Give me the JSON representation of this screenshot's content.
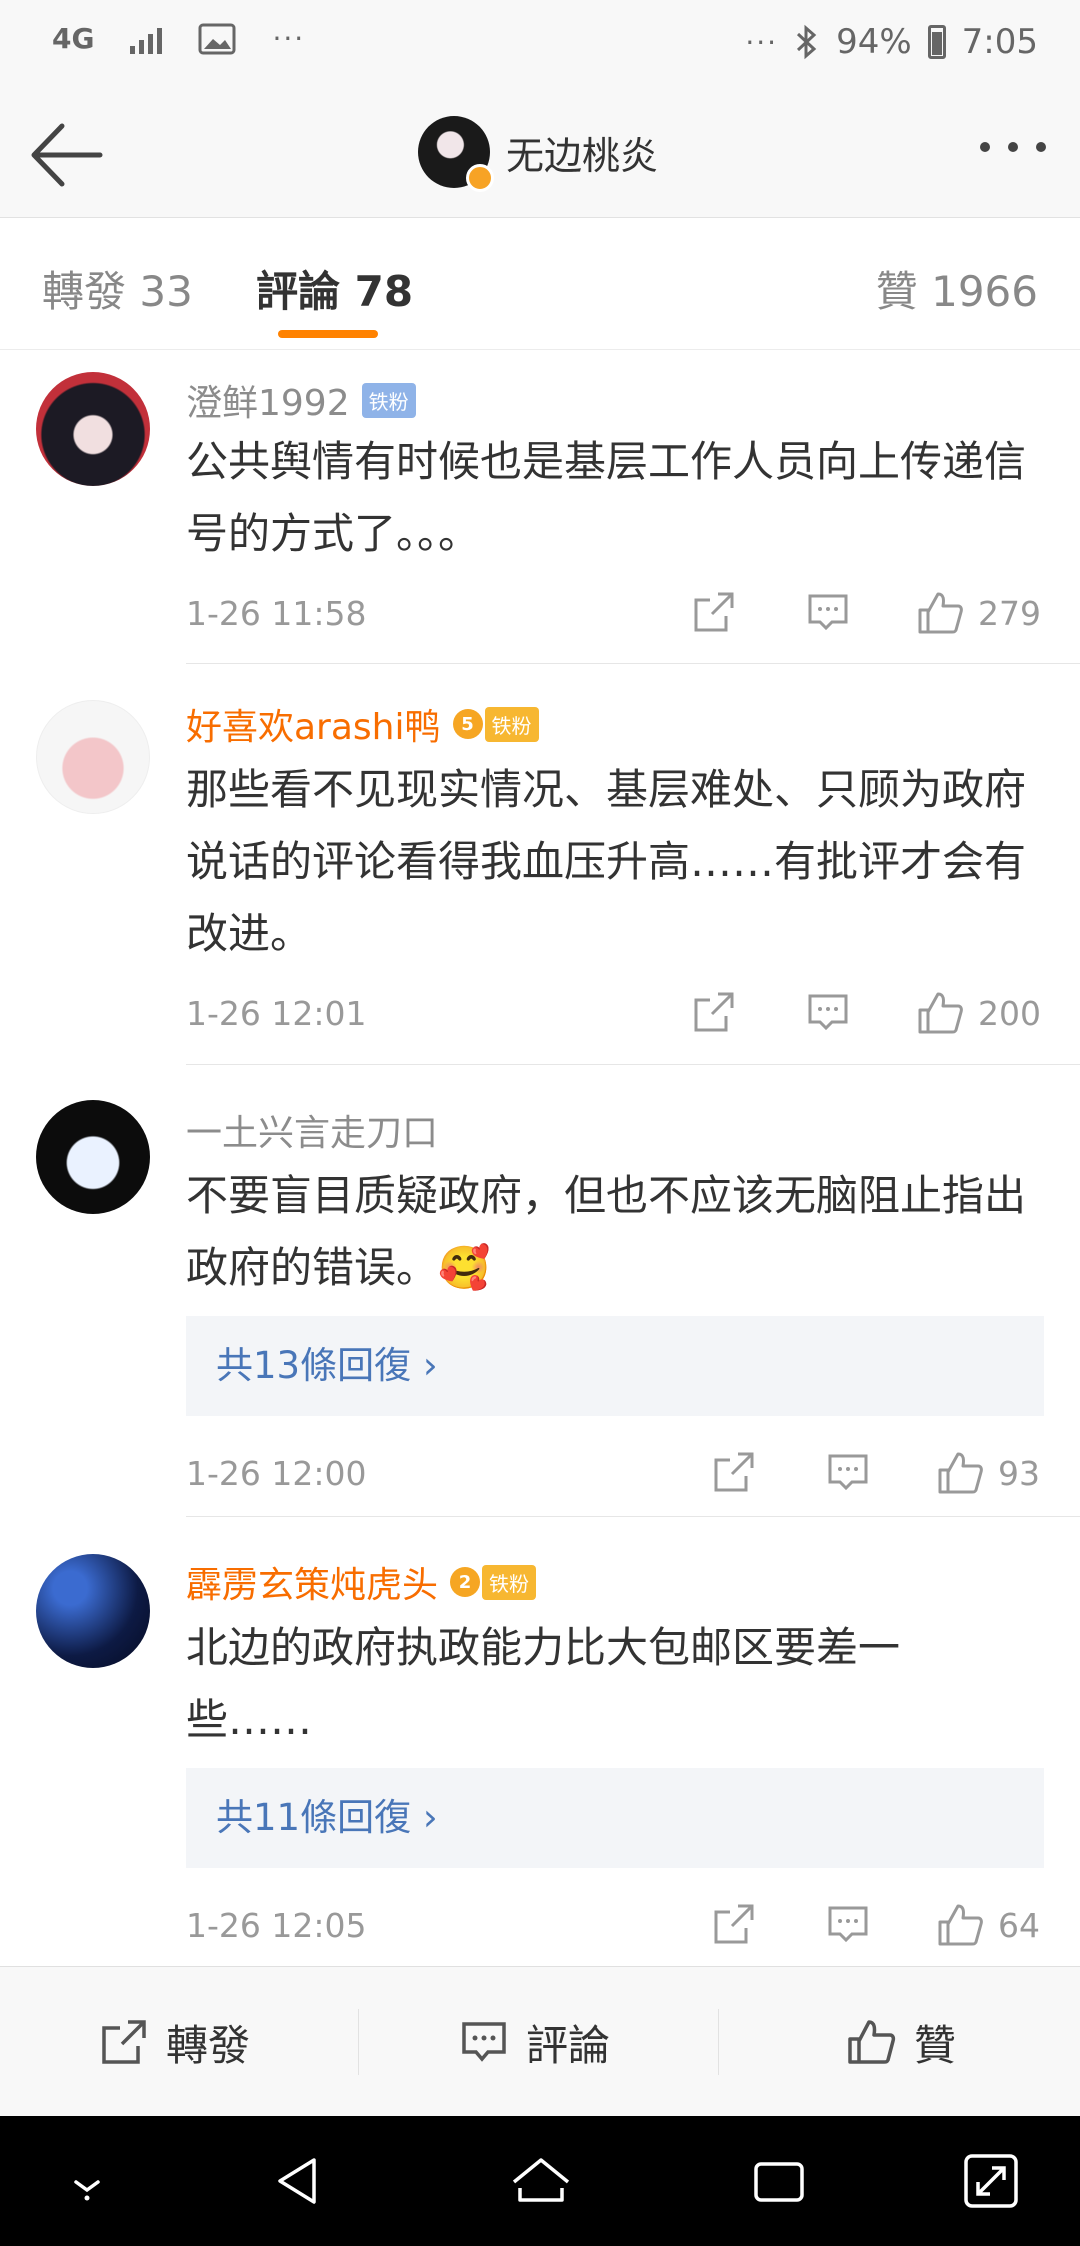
{
  "status_bar": {
    "network": "4G",
    "overflow": "···",
    "right_overflow": "···",
    "battery": "94%",
    "time": "7:05",
    "icons": [
      "signal-icon",
      "image-icon",
      "bluetooth-icon",
      "battery-icon"
    ]
  },
  "header": {
    "title": "无边桃炎"
  },
  "tabs": [
    {
      "label": "轉發 33"
    },
    {
      "label": "評論 78",
      "active": true
    },
    {
      "label": "贊 1966"
    }
  ],
  "comments": [
    {
      "name": "澄鲜1992",
      "badge": "铁粉",
      "text": "公共舆情有时候也是基层工作人员向上传递信号的方式了。。。",
      "time": "1-26 11:58",
      "likes": "279"
    },
    {
      "name": "好喜欢arashi鸭",
      "badge_level": "5",
      "badge": "铁粉",
      "text": "那些看不见现实情况、基层难处、只顾为政府说话的评论看得我血压升高……有批评才会有改进。",
      "time": "1-26 12:01",
      "likes": "200"
    },
    {
      "name": "一土兴言走刀口",
      "text": "不要盲目质疑政府，但也不应该无脑阻止指出政府的错误。",
      "emoji": "🥰",
      "replies": "共13條回復 ›",
      "time": "1-26 12:00",
      "likes": "93"
    },
    {
      "name": "霹雳玄策炖虎头",
      "badge_level": "2",
      "badge": "铁粉",
      "text": "北边的政府执政能力比大包邮区要差一些……",
      "replies": "共11條回復 ›",
      "time": "1-26 12:05",
      "likes": "64"
    }
  ],
  "action_bar": {
    "repost": "轉發",
    "comment": "評論",
    "like": "贊"
  },
  "colors": {
    "accent": "#ff8200",
    "vip_name": "#f86d00",
    "link": "#4976b8"
  }
}
